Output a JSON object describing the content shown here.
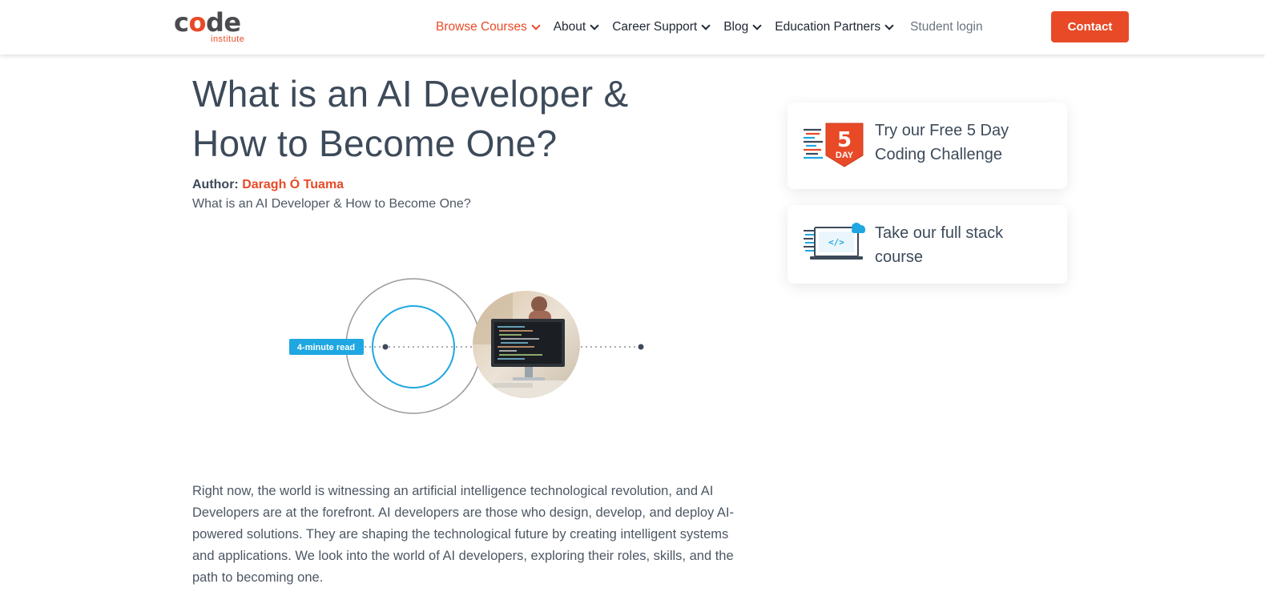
{
  "header": {
    "logo": {
      "word_prefix": "c",
      "word_o": "o",
      "word_suffix": "de",
      "sub": "institute"
    },
    "nav": [
      {
        "label": "Browse Courses",
        "active": true
      },
      {
        "label": "About"
      },
      {
        "label": "Career Support"
      },
      {
        "label": "Blog"
      },
      {
        "label": "Education Partners"
      }
    ],
    "student_login": "Student login",
    "contact_label": "Contact"
  },
  "article": {
    "title": "What is an AI Developer & How to Become One?",
    "author_label": "Author:",
    "author_name": "Daragh Ó Tuama",
    "subtitle": "What is an AI Developer & How to Become One?",
    "hero": {
      "read_time": "4-minute read"
    },
    "intro": "Right now, the world is witnessing an artificial intelligence technological revolution, and AI Developers are at the forefront. AI developers are those who design, develop, and deploy AI-powered solutions. They are shaping the technological future by creating intelligent systems and applications. We look into the world of AI developers, exploring their roles, skills, and the path to becoming one."
  },
  "sidebar": {
    "cards": [
      {
        "label": "Try our Free 5 Day Coding Challenge",
        "icon": "five-day-badge-icon",
        "badge_number": "5",
        "badge_text": "DAY"
      },
      {
        "label": "Take our full stack course",
        "icon": "laptop-code-icon"
      }
    ]
  },
  "colors": {
    "accent": "#e84a27",
    "text": "#3d4a5a",
    "blue": "#1ea7e1"
  }
}
